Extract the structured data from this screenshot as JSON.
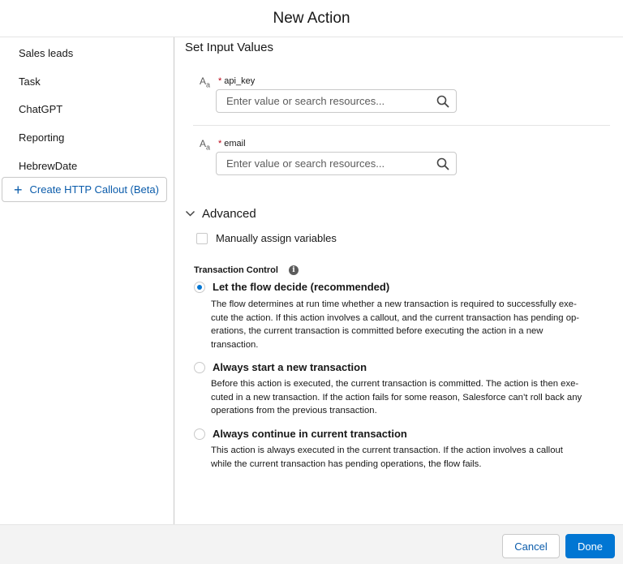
{
  "header": {
    "title": "New Action"
  },
  "sidebar": {
    "items": [
      {
        "label": "Sales leads"
      },
      {
        "label": "Task"
      },
      {
        "label": "ChatGPT"
      },
      {
        "label": "Reporting"
      },
      {
        "label": "HebrewDate"
      }
    ],
    "create_button": {
      "label": "Create HTTP Callout (Beta)"
    }
  },
  "main": {
    "section_title": "Set Input Values",
    "fields": [
      {
        "icon_text": "A",
        "icon_sub": "a",
        "required_mark": "*",
        "label": "api_key",
        "placeholder": "Enter value or search resources..."
      },
      {
        "icon_text": "A",
        "icon_sub": "a",
        "required_mark": "*",
        "label": "email",
        "placeholder": "Enter value or search resources..."
      }
    ],
    "advanced": {
      "label": "Advanced",
      "manual_assign_label": "Manually assign variables",
      "transaction_control_label": "Transaction Control",
      "info_glyph": "i",
      "options": [
        {
          "label": "Let the flow decide (recommended)",
          "checked": true,
          "desc_lines": [
            "The flow determines at run time whether a new transaction is required to successfully exe-",
            "cute the action. If this action involves a callout, and the current transaction has pending op-",
            "erations, the current transaction is committed before executing the action in a new",
            "transaction."
          ]
        },
        {
          "label": "Always start a new transaction",
          "checked": false,
          "desc_lines": [
            "Before this action is executed, the current transaction is committed. The action is then exe-",
            "cuted in a new transaction. If the action fails for some reason, Salesforce can’t roll back any",
            "operations from the previous transaction."
          ]
        },
        {
          "label": "Always continue in current transaction",
          "checked": false,
          "desc_lines": [
            "This action is always executed in the current transaction. If the action involves a callout",
            "while the current transaction has pending operations, the flow fails."
          ]
        }
      ]
    }
  },
  "footer": {
    "cancel_label": "Cancel",
    "done_label": "Done"
  },
  "colors": {
    "brand": "#0176d3",
    "link": "#0b5cab",
    "required": "#ba0517"
  }
}
